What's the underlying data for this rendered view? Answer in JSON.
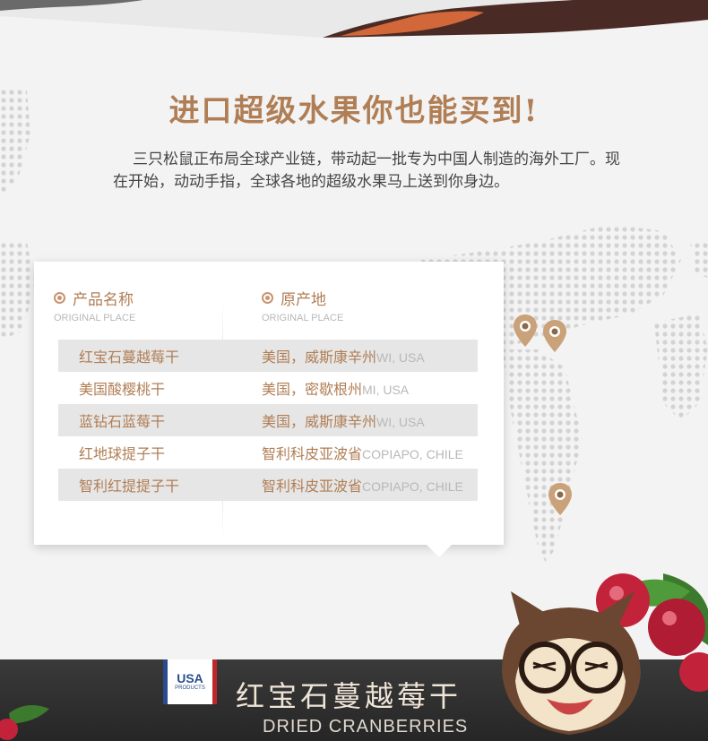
{
  "headline": "进口超级水果你也能买到!",
  "intro": "三只松鼠正布局全球产业链，带动起一批专为中国人制造的海外工厂。现在开始，动动手指，全球各地的超级水果马上送到你身边。",
  "table": {
    "col1": {
      "title": "产品名称",
      "subtitle": "ORIGINAL PLACE"
    },
    "col2": {
      "title": "原产地",
      "subtitle": "ORIGINAL PLACE"
    },
    "rows": [
      {
        "name": "红宝石蔓越莓干",
        "place": "美国，威斯康辛州",
        "place_en": "WI, USA"
      },
      {
        "name": "美国酸樱桃干",
        "place": "美国，密歇根州",
        "place_en": "MI, USA"
      },
      {
        "name": "蓝钻石蓝莓干",
        "place": "美国，威斯康辛州",
        "place_en": "WI, USA"
      },
      {
        "name": "红地球提子干",
        "place": "智利科皮亚波省",
        "place_en": "COPIAPO, CHILE"
      },
      {
        "name": "智利红提提子干",
        "place": "智利科皮亚波省",
        "place_en": "COPIAPO, CHILE"
      }
    ]
  },
  "banner": {
    "badge_main": "USA",
    "badge_sub": "PRODUCTS",
    "title": "红宝石蔓越莓干",
    "subtitle": "DRIED CRANBERRIES"
  },
  "colors": {
    "accent": "#b07e55",
    "muted": "#b8b8b8",
    "row_alt": "#e6e6e6",
    "banner_bg": "#2d2d2d",
    "cranberry": "#c2233a"
  },
  "icons": [
    "location-pin-icon",
    "bullet-circle-icon",
    "world-map-dots",
    "cranberry-illustration",
    "squirrel-mascot"
  ]
}
